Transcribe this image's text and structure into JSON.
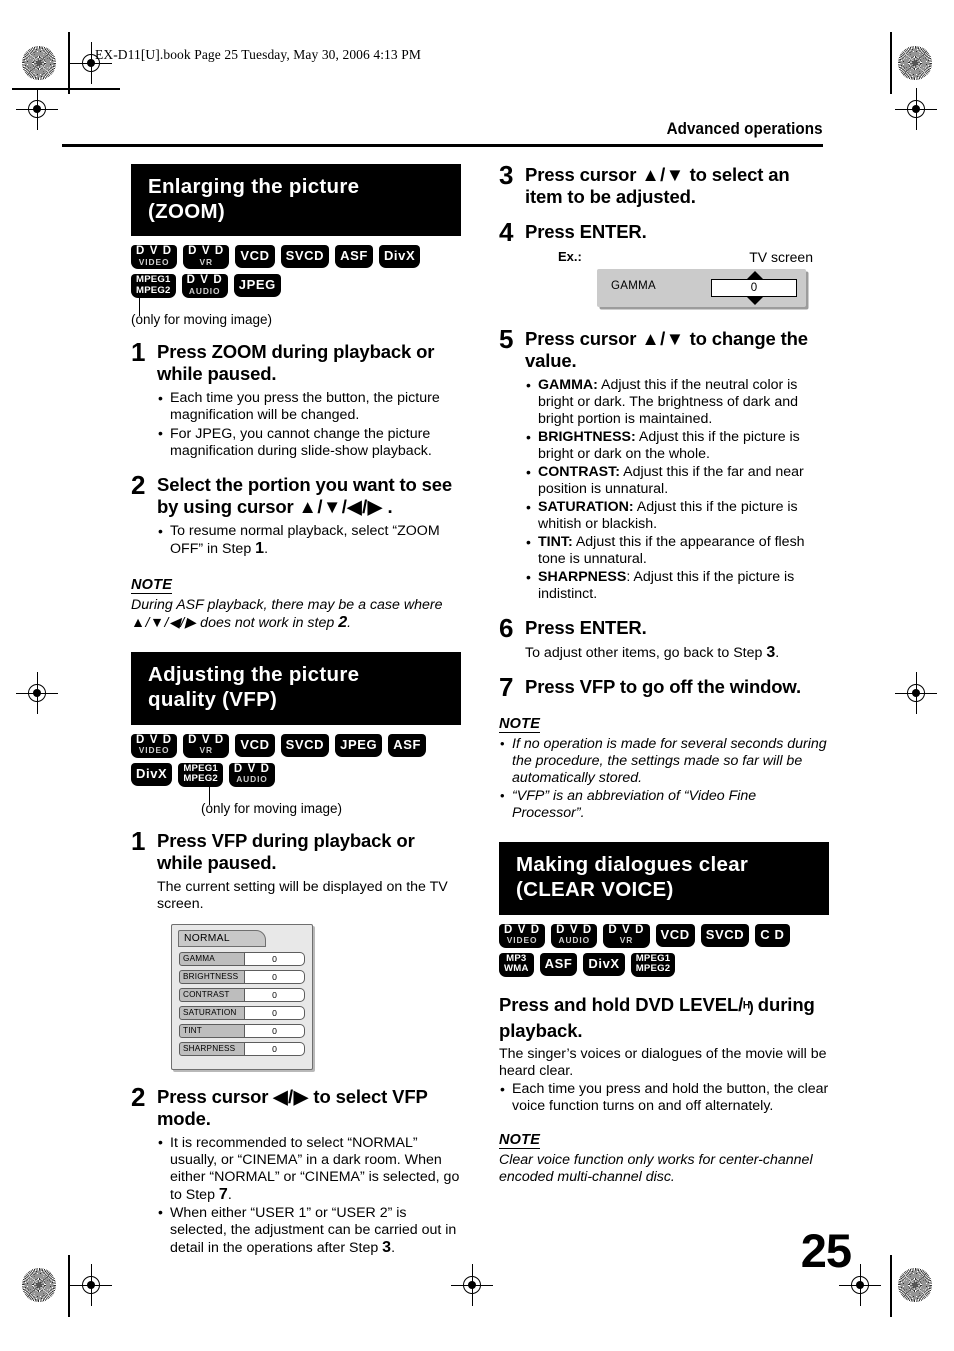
{
  "page": {
    "file_header": "EX-D11[U].book  Page 25  Tuesday, May 30, 2006  4:13 PM",
    "running_head": "Advanced operations",
    "page_number": "25"
  },
  "section_zoom": {
    "banner_line1": "Enlarging the picture",
    "banner_line2": "(ZOOM)",
    "badges": [
      {
        "b1": "D V D",
        "b2": "VIDEO",
        "style": "two"
      },
      {
        "b1": "D V D",
        "b2": "VR",
        "style": "two"
      },
      {
        "b1": "VCD",
        "b2": "",
        "style": "single"
      },
      {
        "b1": "SVCD",
        "b2": "",
        "style": "single"
      },
      {
        "b1": "ASF",
        "b2": "",
        "style": "single"
      },
      {
        "b1": "DivX",
        "b2": "",
        "style": "single"
      },
      {
        "b1": "MPEG1",
        "b2": "MPEG2",
        "style": "equal"
      },
      {
        "b1": "D V D",
        "b2": "AUDIO",
        "style": "two"
      },
      {
        "b1": "JPEG",
        "b2": "",
        "style": "single"
      }
    ],
    "moving_image_caption": "(only for moving image)",
    "step1": {
      "num": "1",
      "title": "Press ZOOM during playback or while paused.",
      "bullets": [
        "Each time you press the button, the picture magnification will be changed.",
        "For JPEG, you cannot change the picture magnification during slide-show playback."
      ]
    },
    "step2": {
      "num": "2",
      "title_a": "Select the portion you want to see by using cursor ",
      "title_cursor": "▲/▼/◀/▶",
      "title_b": " .",
      "bullet_a": "To resume normal playback, select “ZOOM OFF” in Step ",
      "bullet_step": "1",
      "bullet_b": "."
    },
    "note": {
      "label": "NOTE",
      "text_a": "During ASF playback, there may be a case where ",
      "cursor": "▲/▼/◀/▶",
      "text_b": " does not work in step ",
      "step": "2",
      "text_c": "."
    }
  },
  "section_vfp": {
    "banner_line1": "Adjusting the picture",
    "banner_line2": "quality (VFP)",
    "badges": [
      {
        "b1": "D V D",
        "b2": "VIDEO",
        "style": "two"
      },
      {
        "b1": "D V D",
        "b2": "VR",
        "style": "two"
      },
      {
        "b1": "VCD",
        "b2": "",
        "style": "single"
      },
      {
        "b1": "SVCD",
        "b2": "",
        "style": "single"
      },
      {
        "b1": "JPEG",
        "b2": "",
        "style": "single"
      },
      {
        "b1": "ASF",
        "b2": "",
        "style": "single"
      },
      {
        "b1": "DivX",
        "b2": "",
        "style": "single"
      },
      {
        "b1": "MPEG1",
        "b2": "MPEG2",
        "style": "equal"
      },
      {
        "b1": "D V D",
        "b2": "AUDIO",
        "style": "two"
      }
    ],
    "moving_image_caption": "(only for moving image)",
    "step1": {
      "num": "1",
      "title": "Press VFP during playback or while paused.",
      "note": "The current setting will be displayed on the TV screen."
    },
    "osd_panel": {
      "tab_label": "NORMAL",
      "rows": [
        {
          "name": "GAMMA",
          "value": "0"
        },
        {
          "name": "BRIGHTNESS",
          "value": "0"
        },
        {
          "name": "CONTRAST",
          "value": "0"
        },
        {
          "name": "SATURATION",
          "value": "0"
        },
        {
          "name": "TINT",
          "value": "0"
        },
        {
          "name": "SHARPNESS",
          "value": "0"
        }
      ]
    },
    "step2": {
      "num": "2",
      "title_a": "Press cursor ",
      "title_cursor": "◀/▶",
      "title_b": " to select VFP mode.",
      "bullet1_a": "It is recommended to select “NORMAL” usually, or “CINEMA” in a dark room. When either “NORMAL” or “CINEMA” is selected, go to Step ",
      "bullet1_step": "7",
      "bullet1_b": ".",
      "bullet2_a": "When either “USER 1” or “USER 2” is selected, the adjustment can be carried out in detail in the operations after Step ",
      "bullet2_step": "3",
      "bullet2_b": "."
    },
    "step3": {
      "num": "3",
      "title_a": "Press cursor ",
      "title_cursor": "▲/▼",
      "title_b": " to select an item to be adjusted."
    },
    "step4": {
      "num": "4",
      "title": "Press ENTER.",
      "ex_label": "Ex.:",
      "tv_label": "TV screen",
      "osd_name": "GAMMA",
      "osd_value": "0"
    },
    "step5": {
      "num": "5",
      "title_a": "Press cursor ",
      "title_cursor": "▲/▼",
      "title_b": " to change the value.",
      "bullets": [
        {
          "term": "GAMMA:",
          "text": " Adjust this if the neutral color is bright or dark. The brightness of dark and bright portion is maintained."
        },
        {
          "term": "BRIGHTNESS:",
          "text": " Adjust this if the picture is bright or dark on the whole."
        },
        {
          "term": "CONTRAST:",
          "text": " Adjust this if the far and near position is unnatural."
        },
        {
          "term": "SATURATION:",
          "text": " Adjust this if the picture is whitish or blackish."
        },
        {
          "term": "TINT:",
          "text": " Adjust this if the appearance of flesh tone is unnatural."
        },
        {
          "term": "SHARPNESS",
          "text": ": Adjust this if the picture is indistinct."
        }
      ]
    },
    "step6": {
      "num": "6",
      "title": "Press ENTER.",
      "note_a": "To adjust other items, go back to Step ",
      "note_step": "3",
      "note_b": "."
    },
    "step7": {
      "num": "7",
      "title": "Press VFP to go off the window."
    },
    "note": {
      "label": "NOTE",
      "items": [
        "If no operation is made for several seconds during the procedure, the settings made so far will be automatically stored.",
        "“VFP” is an abbreviation of “Video Fine Processor”."
      ]
    }
  },
  "section_clear_voice": {
    "banner_line1": "Making dialogues clear",
    "banner_line2": "(CLEAR VOICE)",
    "badges": [
      {
        "b1": "D V D",
        "b2": "VIDEO",
        "style": "two"
      },
      {
        "b1": "D V D",
        "b2": "AUDIO",
        "style": "two"
      },
      {
        "b1": "D V D",
        "b2": "VR",
        "style": "two"
      },
      {
        "b1": "VCD",
        "b2": "",
        "style": "single"
      },
      {
        "b1": "SVCD",
        "b2": "",
        "style": "single"
      },
      {
        "b1": "C D",
        "b2": "",
        "style": "single"
      },
      {
        "b1": "MP3",
        "b2": "WMA",
        "style": "equal"
      },
      {
        "b1": "ASF",
        "b2": "",
        "style": "single"
      },
      {
        "b1": "DivX",
        "b2": "",
        "style": "single"
      },
      {
        "b1": "MPEG1",
        "b2": "MPEG2",
        "style": "equal"
      }
    ],
    "heading_a": "Press and hold DVD LEVEL/",
    "heading_icon": "ᴴ)",
    "heading_b": " during playback.",
    "body": "The singer’s voices or dialogues of the movie will be heard clear.",
    "bullet": "Each time you press and hold the button, the clear voice function turns on and off alternately.",
    "note": {
      "label": "NOTE",
      "text": "Clear voice function only works for center-channel encoded multi-channel disc."
    }
  }
}
